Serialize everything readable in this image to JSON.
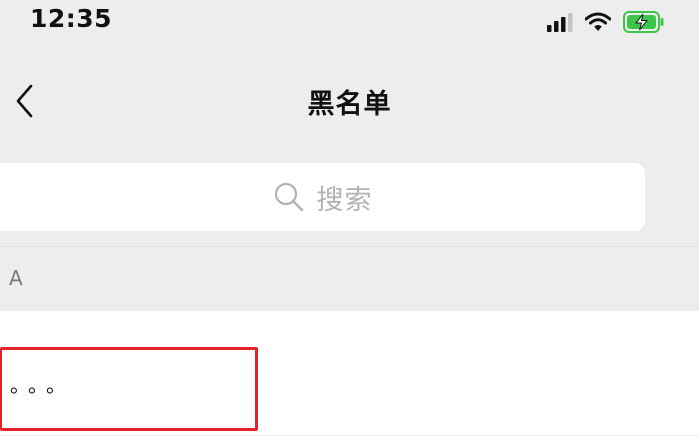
{
  "status_bar": {
    "time": "12:35",
    "icons": [
      "signal-icon",
      "wifi-icon",
      "battery-charging-icon"
    ],
    "battery_color": "#3ec64a"
  },
  "nav": {
    "back_icon": "chevron-left-icon",
    "title": "黑名单"
  },
  "search": {
    "icon": "search-icon",
    "placeholder": "搜索"
  },
  "section": {
    "header": "A"
  },
  "list": {
    "items": [
      {
        "name": "。。。"
      }
    ]
  },
  "colors": {
    "background": "#ededed",
    "card": "#ffffff",
    "highlight": "#e5222c",
    "placeholder": "#b2b2b2"
  }
}
